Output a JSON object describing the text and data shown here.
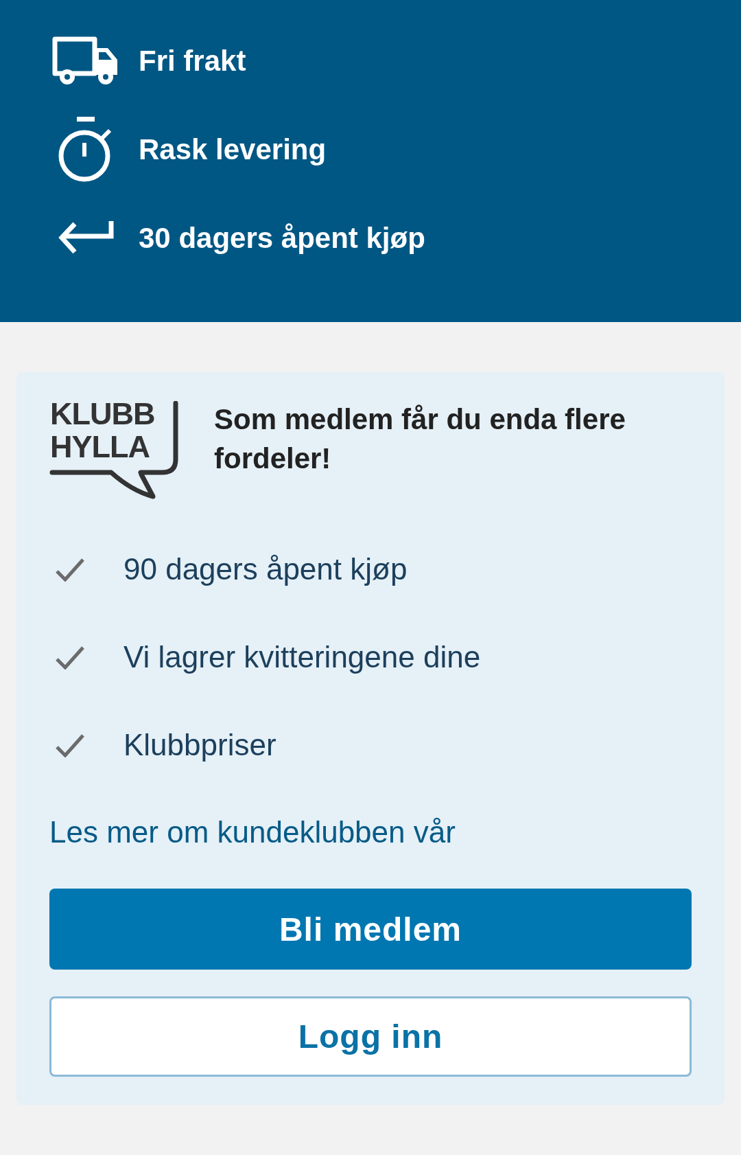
{
  "benefits_banner": {
    "items": [
      {
        "kind": "truck",
        "label": "Fri frakt"
      },
      {
        "kind": "stopwatch",
        "label": "Rask levering"
      },
      {
        "kind": "return",
        "label": "30 dagers åpent kjøp"
      }
    ]
  },
  "club_card": {
    "logo": {
      "lines": [
        "KLUBB",
        "HYLLA"
      ]
    },
    "heading": "Som medlem får du enda flere fordeler!",
    "perks": [
      {
        "label": "90 dagers åpent kjøp"
      },
      {
        "label": "Vi lagrer kvitteringene dine"
      },
      {
        "label": "Klubbpriser"
      }
    ],
    "link": "Les mer om kundeklubben vår",
    "buttons": [
      {
        "kind": "primary",
        "label": "Bli medlem"
      },
      {
        "kind": "secondary",
        "label": "Logg inn"
      }
    ]
  }
}
